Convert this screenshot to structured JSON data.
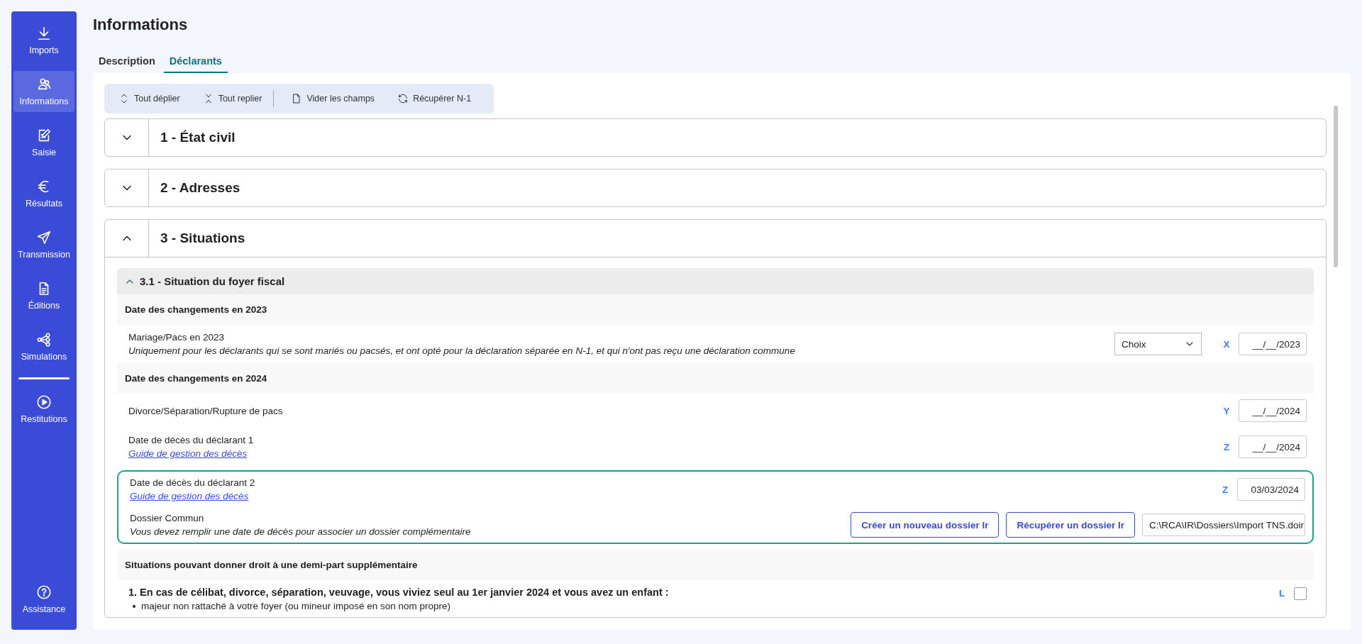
{
  "sidebar": {
    "items": [
      {
        "label": "Imports",
        "kind": "download",
        "selected": false,
        "divider_before": false
      },
      {
        "label": "Informations",
        "kind": "people",
        "selected": true,
        "divider_before": false
      },
      {
        "label": "Saisie",
        "kind": "edit",
        "selected": false,
        "divider_before": false
      },
      {
        "label": "Résultats",
        "kind": "euro",
        "selected": false,
        "divider_before": false
      },
      {
        "label": "Transmission",
        "kind": "send",
        "selected": false,
        "divider_before": false
      },
      {
        "label": "Éditions",
        "kind": "document",
        "selected": false,
        "divider_before": false
      },
      {
        "label": "Simulations",
        "kind": "network",
        "selected": false,
        "divider_before": false
      },
      {
        "label": "Restitutions",
        "kind": "play",
        "selected": false,
        "divider_before": true
      }
    ],
    "footer_item": {
      "label": "Assistance",
      "kind": "help"
    }
  },
  "page_title": "Informations",
  "tabs": [
    {
      "label": "Description",
      "selected": false
    },
    {
      "label": "Déclarants",
      "selected": true
    }
  ],
  "toolbar": {
    "groups": [
      [
        {
          "label": "Tout déplier",
          "kind": "expand"
        },
        {
          "label": "Tout replier",
          "kind": "collapse"
        }
      ],
      [
        {
          "label": "Vider les champs",
          "kind": "file"
        },
        {
          "label": "Récupérer N-1",
          "kind": "refresh"
        }
      ]
    ]
  },
  "sections": [
    {
      "title": "1 - État civil",
      "expanded": false
    },
    {
      "title": "2 - Adresses",
      "expanded": false
    },
    {
      "title": "3 - Situations",
      "expanded": true,
      "subsections": [
        {
          "title": "3.1 - Situation du foyer fiscal",
          "expanded": true,
          "blocks": [
            {
              "heading": "Date des changements en 2023",
              "rows": [
                {
                  "kind": "date",
                  "label": "Mariage/Pacs en 2023",
                  "note": "Uniquement pour les déclarants qui se sont mariés ou pacsés, et ont opté pour la déclaration séparée en N-1, et qui n'ont pas reçu une déclaration commune",
                  "select": "Choix",
                  "code": "X",
                  "date": "__/__/2023",
                  "highlighted": false
                }
              ]
            },
            {
              "heading": "Date des changements en 2024",
              "rows": [
                {
                  "kind": "date",
                  "label": "Divorce/Séparation/Rupture de pacs",
                  "code": "Y",
                  "date": "__/__/2024",
                  "highlighted": false
                },
                {
                  "kind": "date",
                  "label": "Date de décès du déclarant 1",
                  "link": "Guide de gestion des décès",
                  "code": "Z",
                  "date": "__/__/2024",
                  "highlighted": false
                },
                {
                  "kind": "date",
                  "label": "Date de décès du déclarant 2",
                  "link": "Guide de gestion des décès",
                  "code": "Z",
                  "date": "03/03/2024",
                  "highlighted": true
                },
                {
                  "kind": "file",
                  "label": "Dossier Commun",
                  "note": "Vous devez remplir une date de décès pour associer un dossier complémentaire",
                  "buttons": [
                    "Créer un nouveau dossier Ir",
                    "Récupérer un dossier Ir"
                  ],
                  "path": "C:\\RCA\\IR\\Dossiers\\Import TNS.doir",
                  "highlighted": true
                }
              ]
            },
            {
              "heading": "Situations pouvant donner droit à une demi-part supplémentaire",
              "rows": [
                {
                  "kind": "checkbox",
                  "label": "1. En cas de célibat, divorce, séparation, veuvage, vous viviez seul au 1er janvier 2024 et vous avez un enfant :",
                  "bullets": [
                    "majeur non rattaché à votre foyer (ou mineur imposé en son nom propre)"
                  ],
                  "code": "L",
                  "checked": false,
                  "highlighted": false
                }
              ]
            }
          ]
        }
      ]
    }
  ]
}
